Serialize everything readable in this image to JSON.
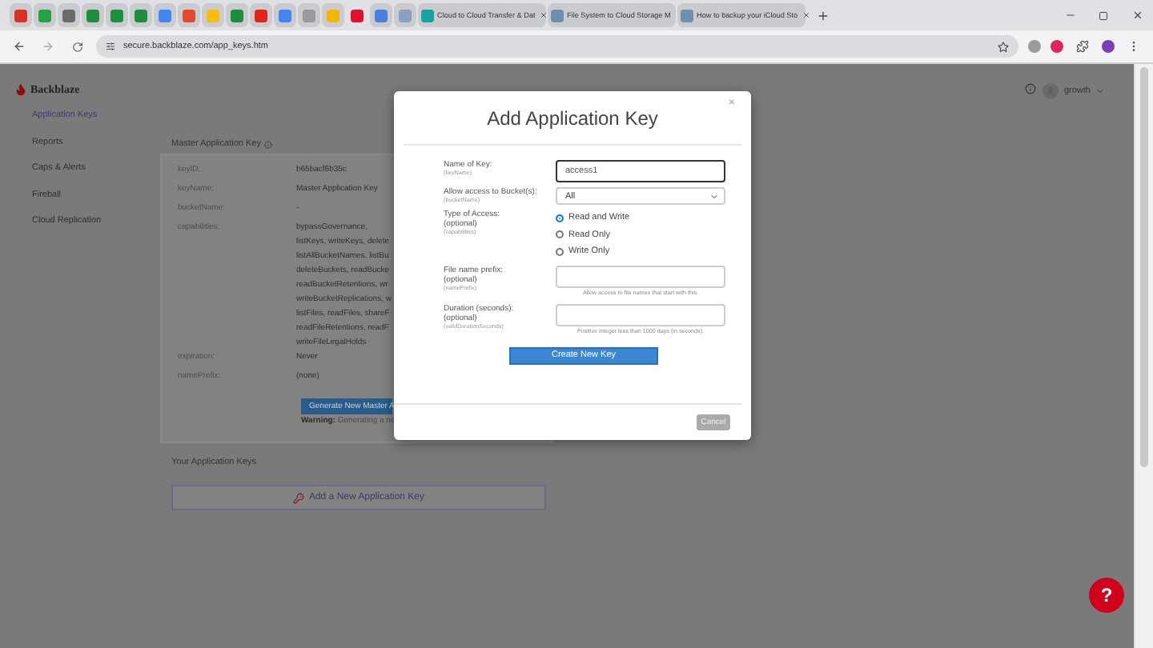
{
  "browser": {
    "tabs": [
      {
        "kind": "pinned",
        "color": "#d93025",
        "selected": false
      },
      {
        "kind": "pinned",
        "color": "#25a244",
        "selected": false
      },
      {
        "kind": "pinned",
        "color": "#6b6b6b",
        "selected": false
      },
      {
        "kind": "pinned",
        "color": "#1e8e3e",
        "selected": false
      },
      {
        "kind": "pinned",
        "color": "#1e8e3e",
        "selected": false
      },
      {
        "kind": "pinned",
        "color": "#1e8e3e",
        "selected": false
      },
      {
        "kind": "pinned",
        "color": "#4285f4",
        "selected": false
      },
      {
        "kind": "pinned",
        "color": "#e04a2f",
        "selected": false
      },
      {
        "kind": "pinned",
        "color": "#fbbc05",
        "selected": false
      },
      {
        "kind": "pinned",
        "color": "#1e8e3e",
        "selected": false
      },
      {
        "kind": "pinned",
        "color": "#e62117",
        "selected": false
      },
      {
        "kind": "pinned",
        "color": "#4285f4",
        "selected": false
      },
      {
        "kind": "pinned",
        "color": "#9a9a9a",
        "selected": false
      },
      {
        "kind": "pinned",
        "color": "#f2b600",
        "selected": false
      },
      {
        "kind": "pinned",
        "color": "#e0102f",
        "selected": true
      },
      {
        "kind": "pinned",
        "color": "#4a7fe0",
        "selected": false
      },
      {
        "kind": "pinned",
        "color": "#8aa0c0",
        "selected": false
      },
      {
        "kind": "page",
        "title": "Cloud to Cloud Transfer & Dat",
        "color": "#16a3a3",
        "selected": false
      },
      {
        "kind": "page",
        "title": "File System to Cloud Storage M",
        "color": "#6f8fb0",
        "selected": false
      },
      {
        "kind": "page",
        "title": "How to backup your iCloud Sto",
        "color": "#6f8fb0",
        "selected": false
      }
    ],
    "address": "secure.backblaze.com/app_keys.htm"
  },
  "sidebar": {
    "logo": "Backblaze",
    "items": [
      {
        "label": "Application Keys",
        "selected": true
      },
      {
        "label": "Reports",
        "selected": false
      },
      {
        "label": "Caps & Alerts",
        "selected": false
      },
      {
        "label": "Fireball",
        "selected": false
      },
      {
        "label": "Cloud Replication",
        "selected": false
      }
    ]
  },
  "user": {
    "name": "growth"
  },
  "master_key": {
    "title": "Master Application Key",
    "fields": [
      {
        "label": "keyID:",
        "lines": [
          "b65bacf6b35c"
        ]
      },
      {
        "label": "keyName:",
        "lines": [
          "Master Application Key"
        ]
      },
      {
        "label": "bucketName:",
        "lines": [
          "-"
        ]
      },
      {
        "label": "capabilities:",
        "lines": [
          "bypassGovernance,",
          "listKeys, writeKeys, delete",
          "listAllBucketNames, listBu",
          "deleteBuckets, readBucke",
          "readBucketRetentions, wr",
          "writeBucketReplications, w",
          "listFiles, readFiles, shareF",
          "readFileRetentions, readF",
          "writeFileLegalHolds"
        ]
      },
      {
        "label": "expiration:",
        "lines": [
          "Never"
        ]
      },
      {
        "label": "namePrefix:",
        "lines": [
          "(none)"
        ]
      }
    ],
    "generate_button": "Generate New Master A",
    "warning": "**Warning:** Generating a ne"
  },
  "your_keys": {
    "title": "Your Application Keys",
    "add_button": "Add a New Application Key"
  },
  "modal": {
    "title": "Add Application Key",
    "close": "×",
    "fields": [
      {
        "kind": "text",
        "label": "Name of Key:",
        "param": "(keyName)",
        "value": "access1",
        "focused": true
      },
      {
        "kind": "select",
        "label": "Allow access to Bucket(s):",
        "param": "(bucketName)",
        "value": "All"
      },
      {
        "kind": "radio",
        "label": "Type of Access:",
        "optional": "(optional)",
        "param": "(capabilities)",
        "options": [
          {
            "label": "Read and Write",
            "selected": true
          },
          {
            "label": "Read Only",
            "selected": false
          },
          {
            "label": "Write Only",
            "selected": false
          }
        ]
      },
      {
        "kind": "text",
        "label": "File name prefix:",
        "optional": "(optional)",
        "param": "(namePrefix)",
        "focused": false,
        "hint": "Allow access to file names that start with this."
      },
      {
        "kind": "text",
        "label": "Duration (seconds):",
        "optional": "(optional)",
        "param": "(validDurationSeconds)",
        "focused": false,
        "hint": "Positive integer less than 1000 days (in seconds)."
      }
    ],
    "submit": "Create New Key",
    "cancel": "Cancel"
  },
  "help": {
    "label": "?"
  }
}
